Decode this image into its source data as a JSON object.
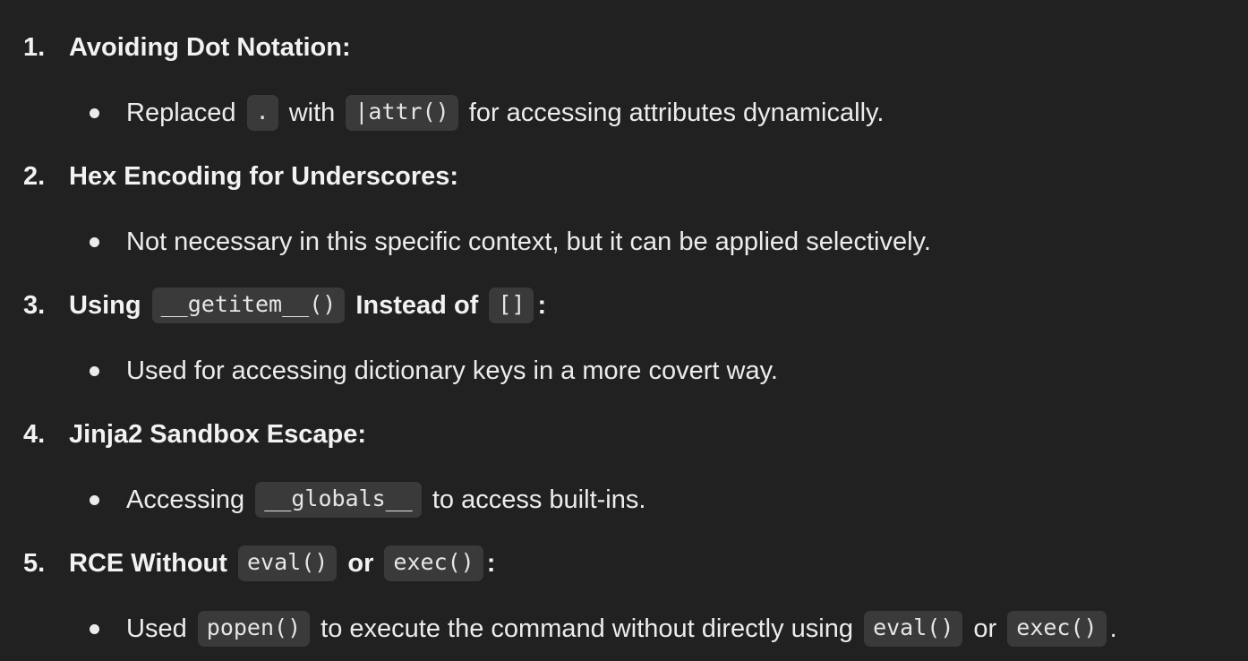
{
  "items": [
    {
      "number": "1.",
      "heading": [
        {
          "t": "text",
          "v": "Avoiding Dot Notation:"
        }
      ],
      "bullet": [
        {
          "t": "text",
          "v": "Replaced "
        },
        {
          "t": "code",
          "v": "."
        },
        {
          "t": "text",
          "v": " with "
        },
        {
          "t": "code",
          "v": "|attr()"
        },
        {
          "t": "text",
          "v": " for accessing attributes dynamically."
        }
      ]
    },
    {
      "number": "2.",
      "heading": [
        {
          "t": "text",
          "v": "Hex Encoding for Underscores:"
        }
      ],
      "bullet": [
        {
          "t": "text",
          "v": "Not necessary in this specific context, but it can be applied selectively."
        }
      ]
    },
    {
      "number": "3.",
      "heading": [
        {
          "t": "text",
          "v": "Using "
        },
        {
          "t": "code",
          "v": "__getitem__()"
        },
        {
          "t": "text",
          "v": " Instead of "
        },
        {
          "t": "code",
          "v": "[]"
        },
        {
          "t": "text",
          "v": ":"
        }
      ],
      "bullet": [
        {
          "t": "text",
          "v": "Used for accessing dictionary keys in a more covert way."
        }
      ]
    },
    {
      "number": "4.",
      "heading": [
        {
          "t": "text",
          "v": "Jinja2 Sandbox Escape:"
        }
      ],
      "bullet": [
        {
          "t": "text",
          "v": "Accessing "
        },
        {
          "t": "code",
          "v": "__globals__"
        },
        {
          "t": "text",
          "v": " to access built-ins."
        }
      ]
    },
    {
      "number": "5.",
      "heading": [
        {
          "t": "text",
          "v": "RCE Without "
        },
        {
          "t": "code",
          "v": "eval()"
        },
        {
          "t": "text",
          "v": " or "
        },
        {
          "t": "code",
          "v": "exec()"
        },
        {
          "t": "text",
          "v": ":"
        }
      ],
      "bullet": [
        {
          "t": "text",
          "v": "Used "
        },
        {
          "t": "code",
          "v": "popen()"
        },
        {
          "t": "text",
          "v": " to execute the command without directly using "
        },
        {
          "t": "code",
          "v": "eval()"
        },
        {
          "t": "text",
          "v": " or "
        },
        {
          "t": "code",
          "v": "exec()"
        },
        {
          "t": "text",
          "v": "."
        }
      ]
    }
  ]
}
